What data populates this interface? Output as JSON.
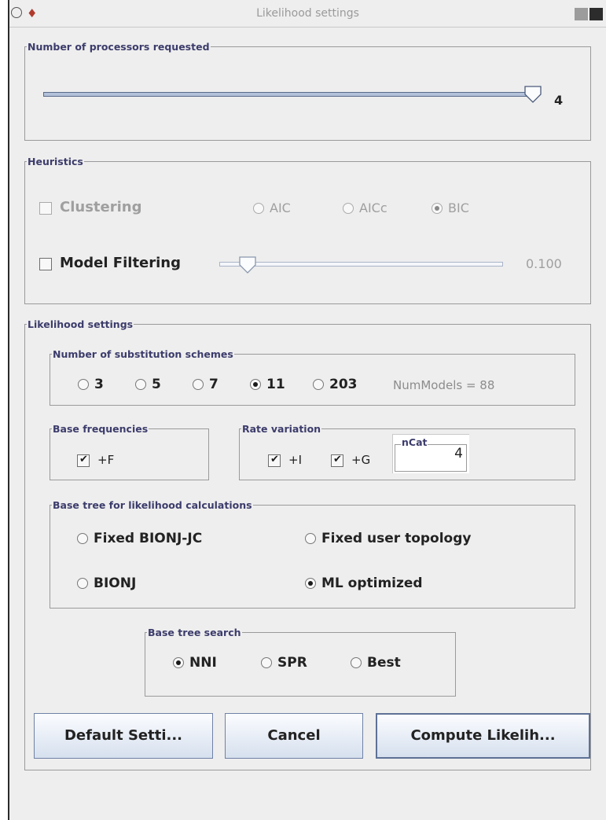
{
  "window": {
    "title": "Likelihood settings",
    "icons": [
      "window-menu-icon",
      "app-icon",
      "minimize-icon",
      "maximize-icon"
    ]
  },
  "processors": {
    "legend": "Number of processors requested",
    "value": "4",
    "slider_fraction": 1.0
  },
  "heuristics": {
    "legend": "Heuristics",
    "clustering_label": "Clustering",
    "clustering_checked": false,
    "criteria": [
      {
        "label": "AIC",
        "selected": false
      },
      {
        "label": "AICc",
        "selected": false
      },
      {
        "label": "BIC",
        "selected": true
      }
    ],
    "model_filtering_label": "Model Filtering",
    "model_filtering_checked": false,
    "model_filtering_value": "0.100",
    "model_filtering_fraction": 0.1
  },
  "likelihood": {
    "legend": "Likelihood settings",
    "schemes": {
      "legend": "Number of substitution schemes",
      "options": [
        {
          "label": "3",
          "selected": false
        },
        {
          "label": "5",
          "selected": false
        },
        {
          "label": "7",
          "selected": false
        },
        {
          "label": "11",
          "selected": true
        },
        {
          "label": "203",
          "selected": false
        }
      ],
      "num_models": "NumModels = 88"
    },
    "base_frequencies": {
      "legend": "Base frequencies",
      "plus_f_label": "+F",
      "plus_f_checked": true
    },
    "rate_variation": {
      "legend": "Rate variation",
      "plus_i_label": "+I",
      "plus_i_checked": true,
      "plus_g_label": "+G",
      "plus_g_checked": true,
      "ncat_legend": "nCat",
      "ncat_value": "4"
    },
    "base_tree": {
      "legend": "Base tree for likelihood calculations",
      "options": [
        {
          "label": "Fixed BIONJ-JC",
          "selected": false
        },
        {
          "label": "Fixed user topology",
          "selected": false
        },
        {
          "label": "BIONJ",
          "selected": false
        },
        {
          "label": "ML optimized",
          "selected": true
        }
      ]
    },
    "tree_search": {
      "legend": "Base tree search",
      "options": [
        {
          "label": "NNI",
          "selected": true
        },
        {
          "label": "SPR",
          "selected": false
        },
        {
          "label": "Best",
          "selected": false
        }
      ]
    }
  },
  "buttons": {
    "default_label": "Default Setti...",
    "cancel_label": "Cancel",
    "compute_label": "Compute Likelih..."
  }
}
